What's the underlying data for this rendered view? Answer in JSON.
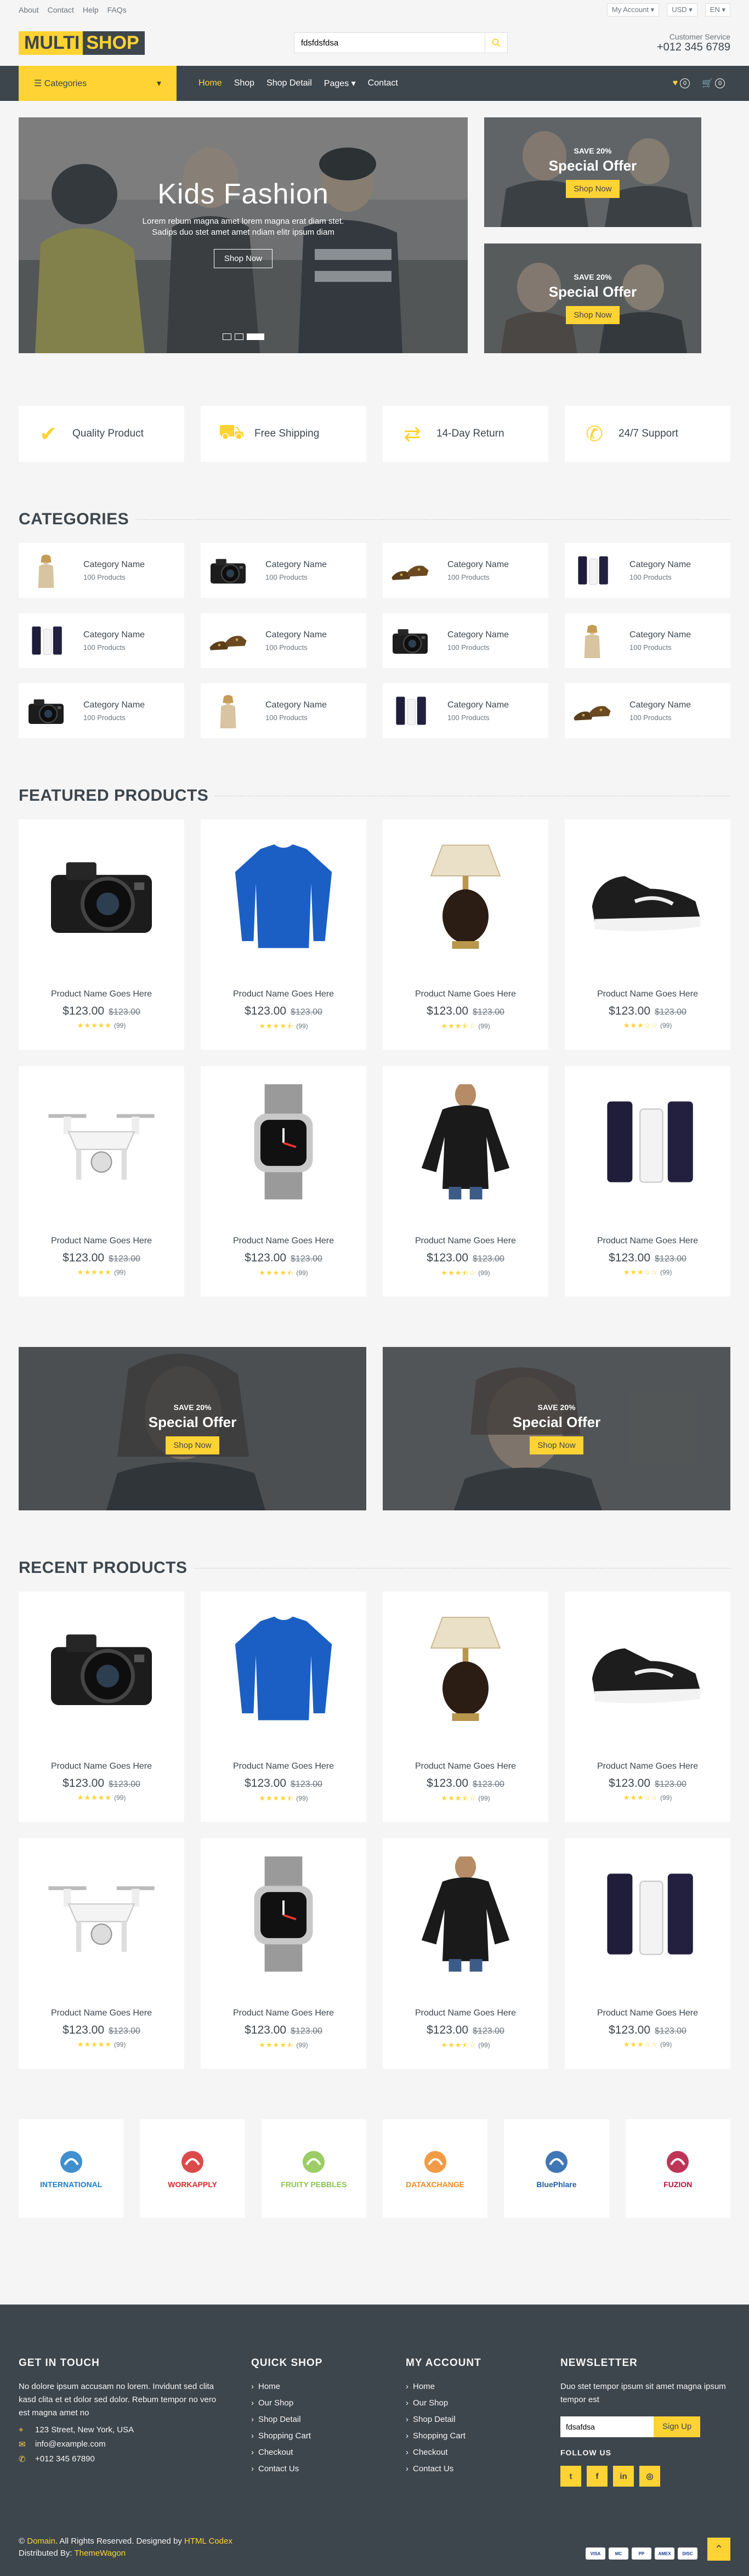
{
  "topbar": {
    "links": [
      "About",
      "Contact",
      "Help",
      "FAQs"
    ],
    "account": "My Account",
    "currency": "USD",
    "language": "EN"
  },
  "header": {
    "logo_a": "MULTI",
    "logo_b": "SHOP",
    "search_value": "fdsfdsfdsa",
    "cs_label": "Customer Service",
    "cs_phone": "+012 345 6789"
  },
  "nav": {
    "categories": "Categories",
    "menu": [
      "Home",
      "Shop",
      "Shop Detail",
      "Pages",
      "Contact"
    ],
    "wishlist_count": "0",
    "cart_count": "0"
  },
  "hero": {
    "title": "Kids Fashion",
    "text": "Lorem rebum magna amet lorem magna erat diam stet. Sadips duo stet amet amet ndiam elitr ipsum diam",
    "button": "Shop Now"
  },
  "offer": {
    "save": "SAVE 20%",
    "title": "Special Offer",
    "button": "Shop Now"
  },
  "features": [
    "Quality Product",
    "Free Shipping",
    "14-Day Return",
    "24/7 Support"
  ],
  "categories_title": "CATEGORIES",
  "categories": [
    {
      "name": "Category Name",
      "count": "100 Products",
      "img": "woman"
    },
    {
      "name": "Category Name",
      "count": "100 Products",
      "img": "camera"
    },
    {
      "name": "Category Name",
      "count": "100 Products",
      "img": "shoes"
    },
    {
      "name": "Category Name",
      "count": "100 Products",
      "img": "cosmetic"
    },
    {
      "name": "Category Name",
      "count": "100 Products",
      "img": "cosmetic"
    },
    {
      "name": "Category Name",
      "count": "100 Products",
      "img": "shoes"
    },
    {
      "name": "Category Name",
      "count": "100 Products",
      "img": "camera"
    },
    {
      "name": "Category Name",
      "count": "100 Products",
      "img": "woman"
    },
    {
      "name": "Category Name",
      "count": "100 Products",
      "img": "camera"
    },
    {
      "name": "Category Name",
      "count": "100 Products",
      "img": "woman"
    },
    {
      "name": "Category Name",
      "count": "100 Products",
      "img": "cosmetic"
    },
    {
      "name": "Category Name",
      "count": "100 Products",
      "img": "shoes"
    }
  ],
  "featured_title": "FEATURED PRODUCTS",
  "recent_title": "RECENT PRODUCTS",
  "products": [
    {
      "name": "Product Name Goes Here",
      "price": "$123.00",
      "old": "$123.00",
      "rating": 5,
      "reviews": "(99)",
      "img": "camera"
    },
    {
      "name": "Product Name Goes Here",
      "price": "$123.00",
      "old": "$123.00",
      "rating": 4.5,
      "reviews": "(99)",
      "img": "sweater"
    },
    {
      "name": "Product Name Goes Here",
      "price": "$123.00",
      "old": "$123.00",
      "rating": 3.5,
      "reviews": "(99)",
      "img": "lamp"
    },
    {
      "name": "Product Name Goes Here",
      "price": "$123.00",
      "old": "$123.00",
      "rating": 3,
      "reviews": "(99)",
      "img": "sneaker"
    },
    {
      "name": "Product Name Goes Here",
      "price": "$123.00",
      "old": "$123.00",
      "rating": 5,
      "reviews": "(99)",
      "img": "drone"
    },
    {
      "name": "Product Name Goes Here",
      "price": "$123.00",
      "old": "$123.00",
      "rating": 4.5,
      "reviews": "(99)",
      "img": "watch"
    },
    {
      "name": "Product Name Goes Here",
      "price": "$123.00",
      "old": "$123.00",
      "rating": 3.5,
      "reviews": "(99)",
      "img": "blouse"
    },
    {
      "name": "Product Name Goes Here",
      "price": "$123.00",
      "old": "$123.00",
      "rating": 3,
      "reviews": "(99)",
      "img": "cosmetic"
    }
  ],
  "vendors": [
    {
      "name": "INTERNATIONAL",
      "color": "#1e7bc6"
    },
    {
      "name": "WORKAPPLY",
      "color": "#d62b2b"
    },
    {
      "name": "FRUITY PEBBLES",
      "color": "#8bc34a"
    },
    {
      "name": "DATAXCHANGE",
      "color": "#f08a24"
    },
    {
      "name": "BluePhlare",
      "color": "#1f5fa8"
    },
    {
      "name": "FUZION",
      "color": "#b3123b"
    }
  ],
  "footer": {
    "touch_title": "GET IN TOUCH",
    "touch_text": "No dolore ipsum accusam no lorem. Invidunt sed clita kasd clita et et dolor sed dolor. Rebum tempor no vero est magna amet no",
    "address": "123 Street, New York, USA",
    "email": "info@example.com",
    "phone": "+012 345 67890",
    "quick_title": "QUICK SHOP",
    "account_title": "MY ACCOUNT",
    "links": [
      "Home",
      "Our Shop",
      "Shop Detail",
      "Shopping Cart",
      "Checkout",
      "Contact Us"
    ],
    "news_title": "NEWSLETTER",
    "news_text": "Duo stet tempor ipsum sit amet magna ipsum tempor est",
    "news_value": "fdsafdsa",
    "news_button": "Sign Up",
    "follow": "FOLLOW US",
    "social": [
      "t",
      "f",
      "in",
      "◎"
    ],
    "copy_pre": "©",
    "copy_domain": "Domain",
    "copy_mid": ". All Rights Reserved. Designed by",
    "copy_designer": "HTML Codex",
    "dist_pre": "Distributed By:",
    "dist_name": "ThemeWagon",
    "payments": [
      "VISA",
      "MC",
      "PP",
      "AMEX",
      "DISC"
    ]
  },
  "colors": {
    "accent": "#ffd333",
    "dark": "#3d464d",
    "bg": "#f5f5f5",
    "text": "#6c757d"
  }
}
